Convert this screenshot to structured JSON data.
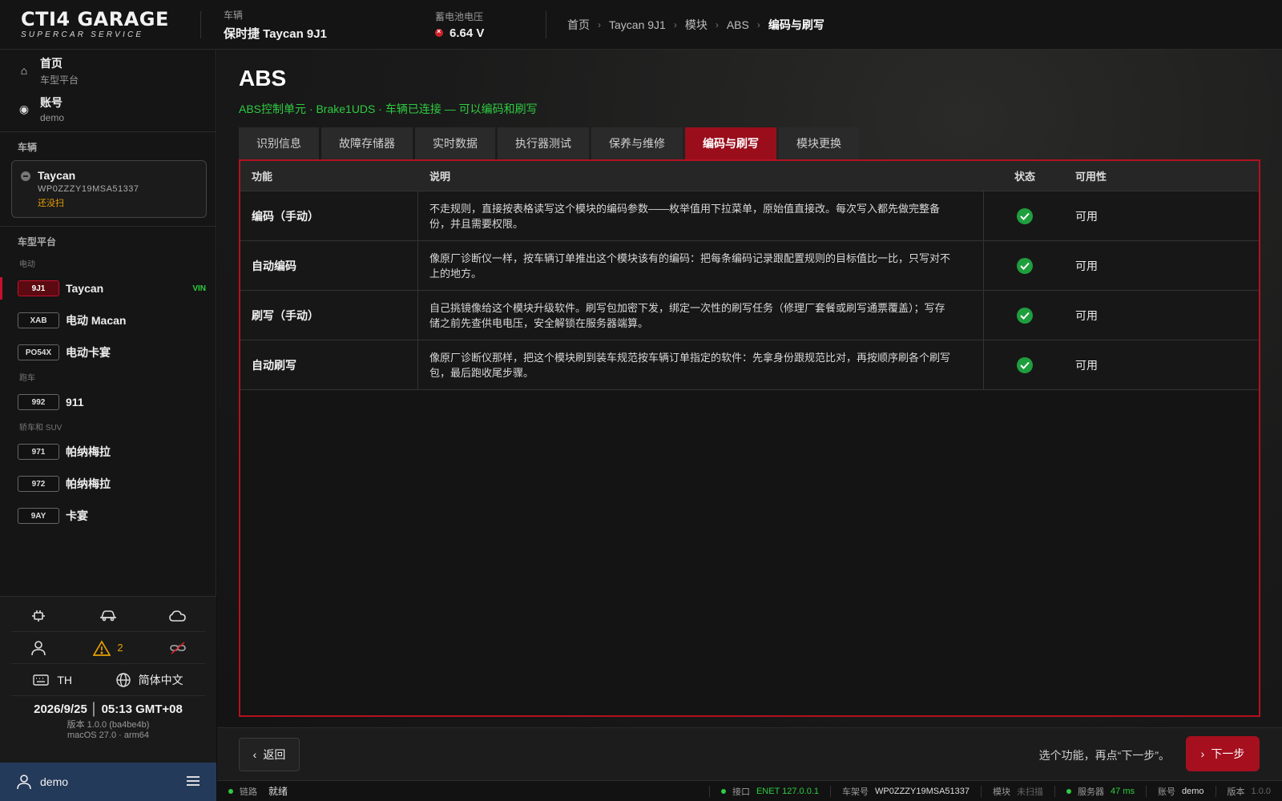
{
  "brand": {
    "name": "CTI4 GARAGE",
    "tagline": "SUPERCAR SERVICE"
  },
  "topbar": {
    "vehicle_label": "车辆",
    "vehicle_value": "保时捷 Taycan 9J1",
    "battery_label": "蓄电池电压",
    "battery_value": "6.64 V",
    "battery_status_color": "#d0202a",
    "breadcrumb": [
      "首页",
      "Taycan 9J1",
      "模块",
      "ABS",
      "编码与刷写"
    ]
  },
  "sidebar": {
    "nav": [
      {
        "title": "首页",
        "sub": "车型平台",
        "icon": "home-icon"
      },
      {
        "title": "账号",
        "sub": "demo",
        "icon": "radio-icon"
      }
    ],
    "vehicle_section": "车辆",
    "vehicle_card": {
      "name": "Taycan",
      "vin": "WP0ZZZY19MSA51337",
      "status": "还没扫"
    },
    "platform_section": "车型平台",
    "groups": [
      {
        "label": "电动",
        "items": [
          {
            "code": "9J1",
            "name": "Taycan",
            "tag": "VIN",
            "active": true
          },
          {
            "code": "XAB",
            "name": "电动 Macan"
          },
          {
            "code": "PO54X",
            "name": "电动卡宴"
          }
        ]
      },
      {
        "label": "跑车",
        "items": [
          {
            "code": "992",
            "name": "911"
          }
        ]
      },
      {
        "label": "轿车和 SUV",
        "items": [
          {
            "code": "971",
            "name": "帕纳梅拉"
          },
          {
            "code": "972",
            "name": "帕纳梅拉"
          },
          {
            "code": "9AY",
            "name": "卡宴"
          }
        ]
      }
    ],
    "bottom": {
      "icons_row1": [
        "plug-icon",
        "car-icon",
        "cloud-icon"
      ],
      "icons_row2": [
        "user-icon",
        "warning-icon",
        "link-off-icon"
      ],
      "warning_count": "2",
      "keyboard_label": "TH",
      "language_label": "简体中文",
      "datetime": "2026/9/25 │ 05:13 GMT+08",
      "version": "版本 1.0.0 (ba4be4b)",
      "os": "macOS 27.0 · arm64"
    },
    "user": "demo"
  },
  "main": {
    "title": "ABS",
    "subtitle": "ABS控制单元 · Brake1UDS · 车辆已连接 — 可以编码和刷写",
    "tabs": [
      "识别信息",
      "故障存储器",
      "实时数据",
      "执行器测试",
      "保养与维修",
      "编码与刷写",
      "模块更换"
    ],
    "active_tab": 5,
    "table": {
      "headers": [
        "功能",
        "说明",
        "状态",
        "可用性"
      ],
      "rows": [
        {
          "function": "编码（手动）",
          "desc_1": "不走规则，直接按表格读写这个模块的编码参数——枚举值用下拉菜单，原始值直接改。每次写入都先做完整备",
          "desc_2": "份，并且需要权限。",
          "availability": "可用"
        },
        {
          "function": "自动编码",
          "desc_1": "像原厂诊断仪一样，按车辆订单推出这个模块该有的编码：把每条编码记录跟配置规则的目标值比一比，只写对不",
          "desc_2": "上的地方。",
          "availability": "可用"
        },
        {
          "function": "刷写（手动）",
          "desc_1": "自己挑镜像给这个模块升级软件。刷写包加密下发，绑定一次性的刷写任务（修理厂套餐或刷写通票覆盖）；写存",
          "desc_2": "储之前先查供电电压，安全解锁在服务器端算。",
          "availability": "可用"
        },
        {
          "function": "自动刷写",
          "desc_1": "像原厂诊断仪那样，把这个模块刷到装车规范按车辆订单指定的软件：先拿身份跟规范比对，再按顺序刷各个刷写",
          "desc_2": "包，最后跑收尾步骤。",
          "availability": "可用"
        }
      ]
    }
  },
  "footer": {
    "back_label": "返回",
    "hint": "选个功能，再点“下一步”。",
    "next_label": "下一步"
  },
  "statusbar": {
    "link_label": "链路",
    "link_value": "就绪",
    "port_label": "接口",
    "port_value": "ENET 127.0.0.1",
    "vin_label": "车架号",
    "vin_value": "WP0ZZZY19MSA51337",
    "module_label": "模块",
    "module_value": "未扫描",
    "server_label": "服务器",
    "server_value": "47 ms",
    "account_label": "账号",
    "account_value": "demo",
    "version_label": "版本",
    "version_value": "1.0.0"
  },
  "colors": {
    "accent_red": "#9a0e1c",
    "ok_green": "#2ecc40",
    "warn_amber": "#e8a000",
    "user_bar": "#243a5a"
  }
}
